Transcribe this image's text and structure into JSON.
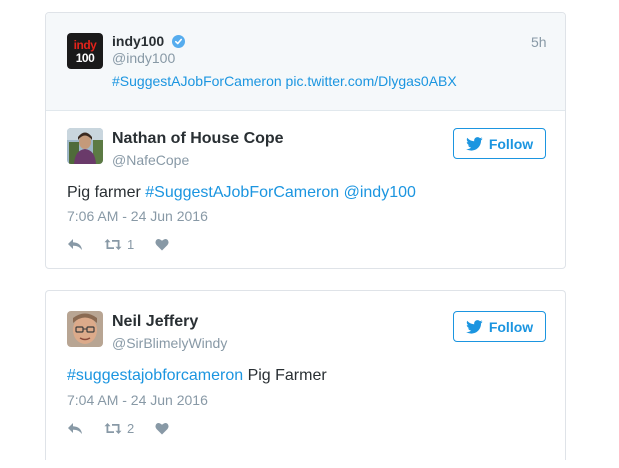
{
  "quoted_tweet": {
    "name": "indy100",
    "handle": "@indy100",
    "time": "5h",
    "hashtag": "#SuggestAJobForCameron",
    "pic_link": "pic.twitter.com/Dlygas0ABX",
    "logo_line1": "indy",
    "logo_line2": "100"
  },
  "tweets": [
    {
      "name": "Nathan of House Cope",
      "handle": "@NafeCope",
      "text_plain": "Pig farmer",
      "hashtag": "#SuggestAJobForCameron",
      "mention": "@indy100",
      "date": "7:06 AM - 24 Jun 2016",
      "retweets": "1",
      "follow_label": "Follow"
    },
    {
      "name": "Neil Jeffery",
      "handle": "@SirBlimelyWindy",
      "hashtag": "#suggestajobforcameron",
      "text_plain": "Pig Farmer",
      "date": "7:04 AM - 24 Jun 2016",
      "retweets": "2",
      "follow_label": "Follow"
    }
  ],
  "colors": {
    "link": "#1b95e0",
    "muted": "#8899a6",
    "verified": "#55acee",
    "quote_bg": "#f5f8fa"
  },
  "icons": [
    "verified-badge-icon",
    "twitter-bird-icon",
    "reply-icon",
    "retweet-icon",
    "like-heart-icon"
  ]
}
